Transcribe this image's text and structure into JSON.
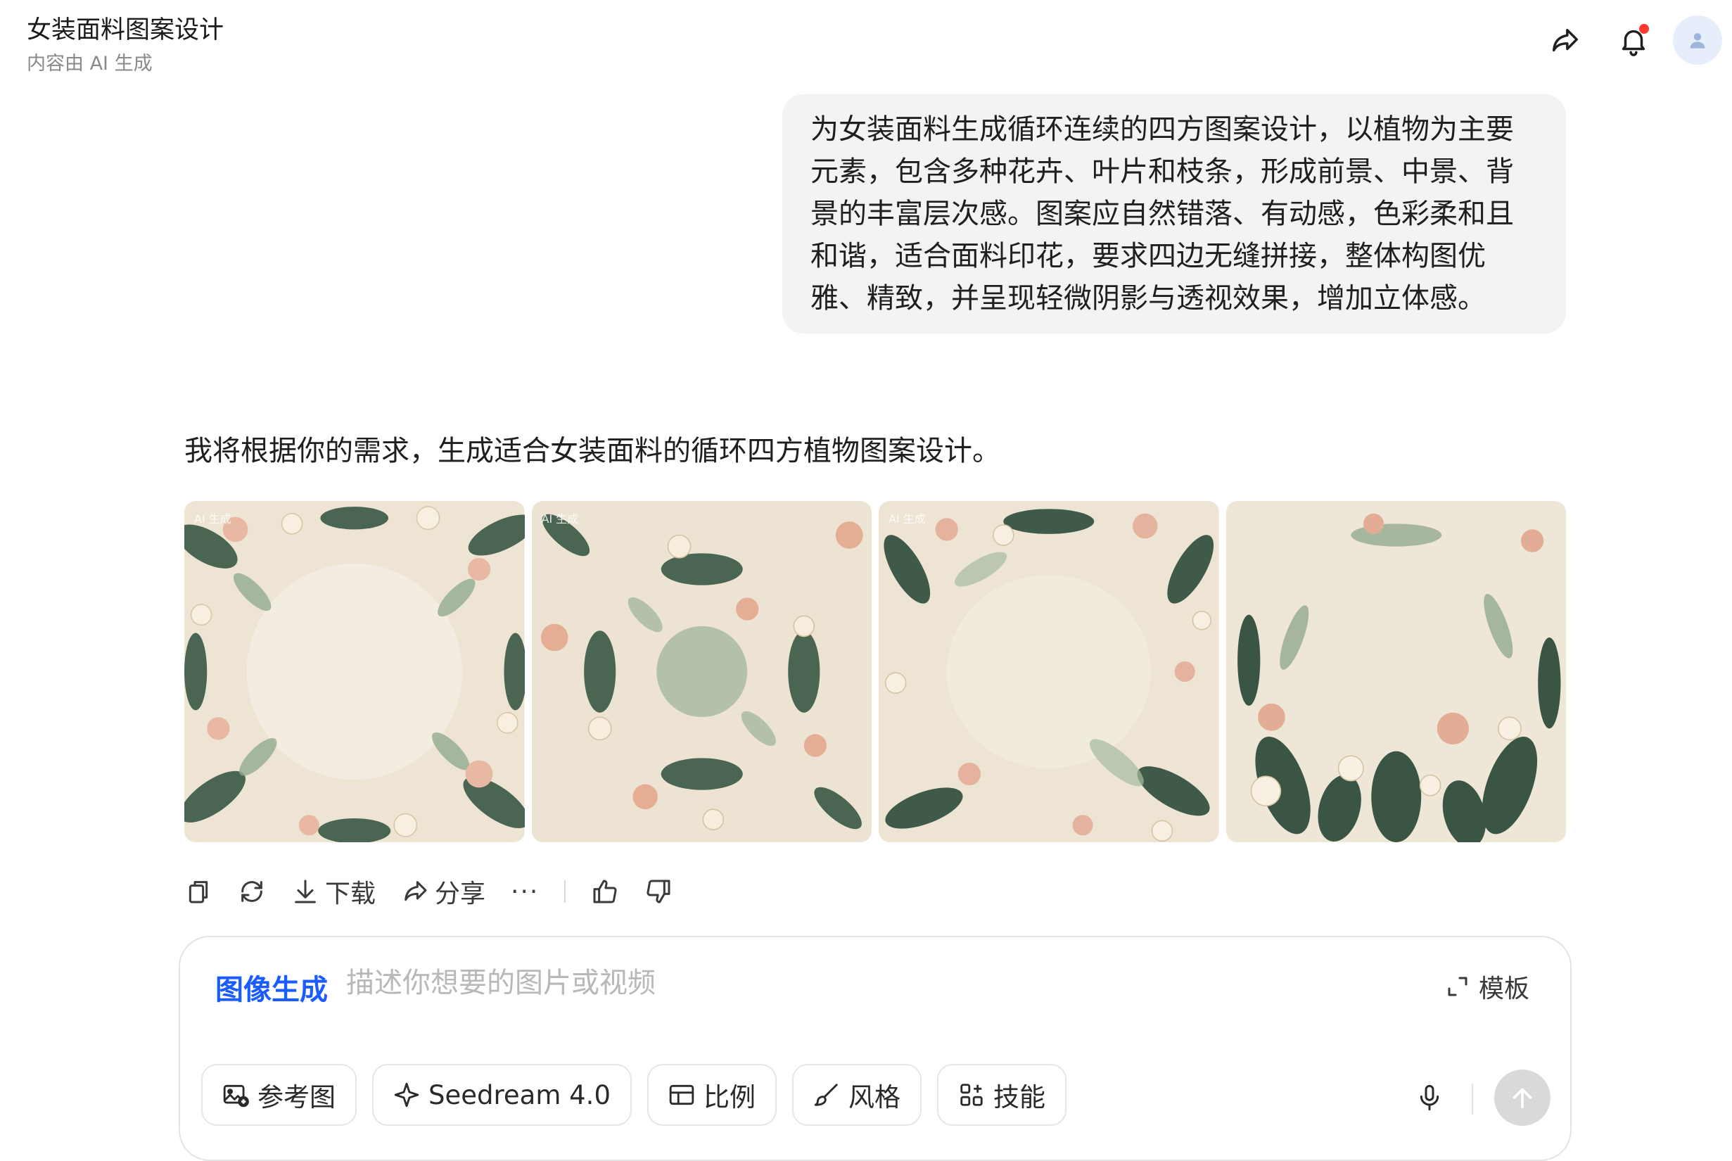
{
  "header": {
    "title": "女装面料图案设计",
    "subtitle": "内容由 AI 生成",
    "share_icon": "share-icon",
    "bell_icon": "bell-icon",
    "avatar_icon": "user-avatar-icon"
  },
  "user_message": "为女装面料生成循环连续的四方图案设计，以植物为主要元素，包含多种花卉、叶片和枝条，形成前景、中景、背景的丰富层次感。图案应自然错落、有动感，色彩柔和且和谐，适合面料印花，要求四边无缝拼接，整体构图优雅、精致，并呈现轻微阴影与透视效果，增加立体感。",
  "assistant": {
    "reply": "我将根据你的需求，生成适合女装面料的循环四方植物图案设计。",
    "images": [
      {
        "badge": "AI 生成"
      },
      {
        "badge": "AI 生成"
      },
      {
        "badge": "AI 生成"
      },
      {
        "badge": ""
      }
    ],
    "actions": {
      "download": "下载",
      "share": "分享",
      "more": "···"
    }
  },
  "composer": {
    "mode": "图像生成",
    "placeholder": "描述你想要的图片或视频",
    "value": "",
    "template": "模板",
    "tools": {
      "reference": "参考图",
      "model": "Seedream 4.0",
      "ratio": "比例",
      "style": "风格",
      "skills": "技能"
    }
  },
  "colors": {
    "accent": "#1a5cff",
    "notification": "#ff3b30",
    "bubble": "#f3f3f3",
    "pattern_bg": "#efe6d6",
    "leaf_dark": "#3f5a48",
    "leaf_light": "#8fa88c",
    "flower_peach": "#e8b5a0",
    "flower_cream": "#f6eddc"
  }
}
